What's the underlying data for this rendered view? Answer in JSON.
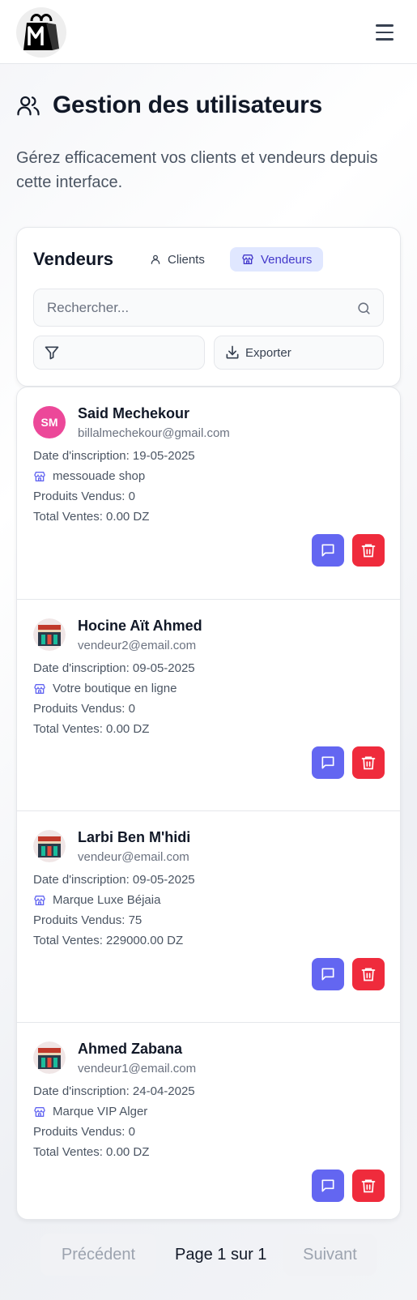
{
  "header": {
    "logo_icon": "shopping-bag-m-logo",
    "menu_icon": "hamburger-icon"
  },
  "page": {
    "title": "Gestion des utilisateurs",
    "title_icon": "users-icon",
    "subtitle": "Gérez efficacement vos clients et vendeurs depuis cette interface."
  },
  "panel": {
    "heading": "Vendeurs",
    "tabs": [
      {
        "label": "Clients",
        "icon": "user-icon",
        "active": false
      },
      {
        "label": "Vendeurs",
        "icon": "store-icon",
        "active": true
      }
    ],
    "search": {
      "placeholder": "Rechercher...",
      "value": ""
    },
    "filter_icon": "filter-icon",
    "export_label": "Exporter"
  },
  "vendors": [
    {
      "initials": "SM",
      "name": "Said Mechekour",
      "email": "billalmechekour@gmail.com",
      "date_label": "Date d'inscription: 19-05-2025",
      "shop": "messouade shop",
      "products_label": "Produits Vendus: 0",
      "sales_label": "Total Ventes: 0.00 DZ"
    },
    {
      "name": "Hocine Aït Ahmed",
      "email": "vendeur2@email.com",
      "date_label": "Date d'inscription: 09-05-2025",
      "shop": "Votre boutique en ligne",
      "products_label": "Produits Vendus: 0",
      "sales_label": "Total Ventes: 0.00 DZ"
    },
    {
      "name": "Larbi Ben M'hidi",
      "email": "vendeur@email.com",
      "date_label": "Date d'inscription: 09-05-2025",
      "shop": "Marque Luxe Béjaia",
      "products_label": "Produits Vendus: 75",
      "sales_label": "Total Ventes: 229000.00 DZ"
    },
    {
      "name": "Ahmed Zabana",
      "email": "vendeur1@email.com",
      "date_label": "Date d'inscription: 24-04-2025",
      "shop": "Marque VIP Alger",
      "products_label": "Produits Vendus: 0",
      "sales_label": "Total Ventes: 0.00 DZ"
    }
  ],
  "pagination": {
    "prev": "Précédent",
    "info": "Page 1 sur 1",
    "next": "Suivant"
  },
  "colors": {
    "accent": "#6366f1",
    "danger": "#ef2b3c",
    "avatar_pink": "#ec4899",
    "tab_active_bg": "#e0e7ff"
  }
}
